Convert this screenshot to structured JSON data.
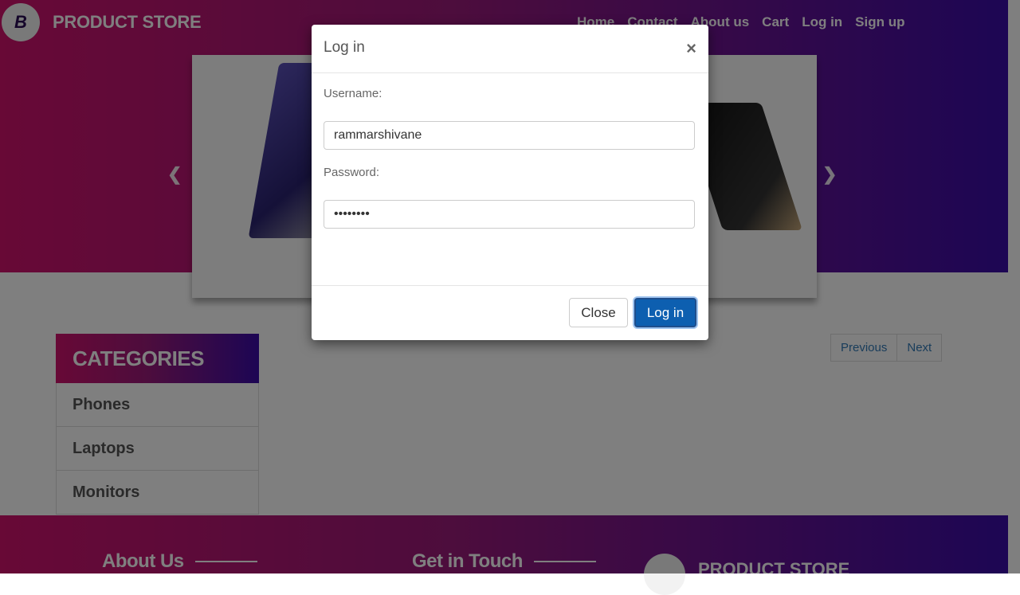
{
  "header": {
    "logo_letter": "B",
    "brand": "PRODUCT STORE",
    "nav": [
      "Home",
      "Contact",
      "About us",
      "Cart",
      "Log in",
      "Sign up"
    ]
  },
  "carousel": {
    "prev_icon": "chevron-left-icon",
    "next_icon": "chevron-right-icon"
  },
  "categories": {
    "title": "CATEGORIES",
    "items": [
      "Phones",
      "Laptops",
      "Monitors"
    ]
  },
  "pager": {
    "previous": "Previous",
    "next": "Next"
  },
  "footer": {
    "about": "About Us",
    "contact": "Get in Touch",
    "brand": "PRODUCT STORE"
  },
  "modal": {
    "title": "Log in",
    "close_symbol": "×",
    "username_label": "Username:",
    "username_value": "rammarshivane",
    "password_label": "Password:",
    "password_value": "rammarsh",
    "close_button": "Close",
    "login_button": "Log in"
  },
  "colors": {
    "gradient_start": "#d0126d",
    "gradient_end": "#3a0ca8",
    "primary_button": "#0d5fb0"
  }
}
